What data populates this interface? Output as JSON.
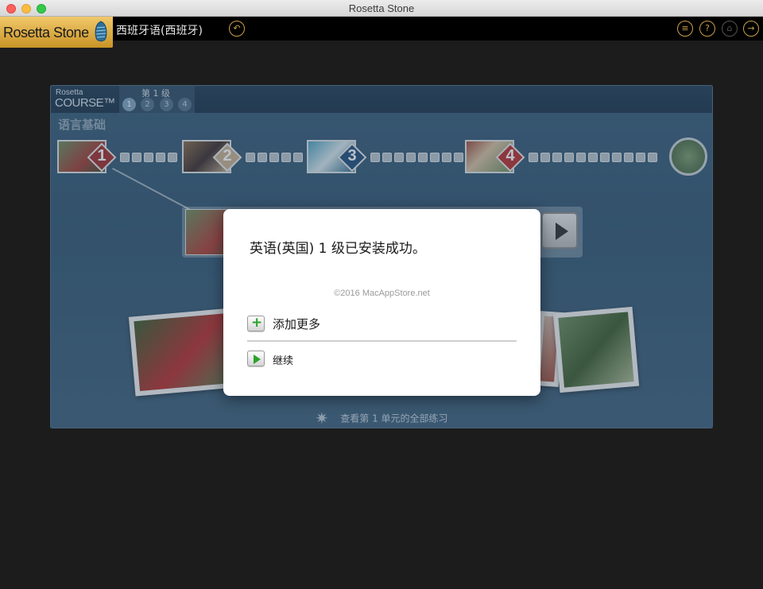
{
  "window": {
    "title": "Rosetta Stone"
  },
  "header": {
    "logo_text": "Rosetta Stone",
    "language": "西班牙语(西班牙)"
  },
  "course": {
    "brand_small": "Rosetta",
    "brand_big": "COURSE™",
    "level_label": "第 1 级",
    "levels": [
      "1",
      "2",
      "3",
      "4"
    ],
    "title": "语言基础",
    "units": [
      {
        "num": "1",
        "color": "#a02a2a"
      },
      {
        "num": "2",
        "color": "#c8b090"
      },
      {
        "num": "3",
        "color": "#1e4a7a"
      },
      {
        "num": "4",
        "color": "#b82a2a"
      }
    ],
    "view_all_link": "查看第 1 单元的全部练习"
  },
  "dialog": {
    "message": "英语(英国) 1 级已安装成功。",
    "watermark": "©2016 MacAppStore.net",
    "add_more_label": "添加更多",
    "continue_label": "继续"
  },
  "colors": {
    "logo_gold": "#e0b04c",
    "accent_green": "#2aa32a",
    "header_icon_gold": "#c9a04a"
  }
}
